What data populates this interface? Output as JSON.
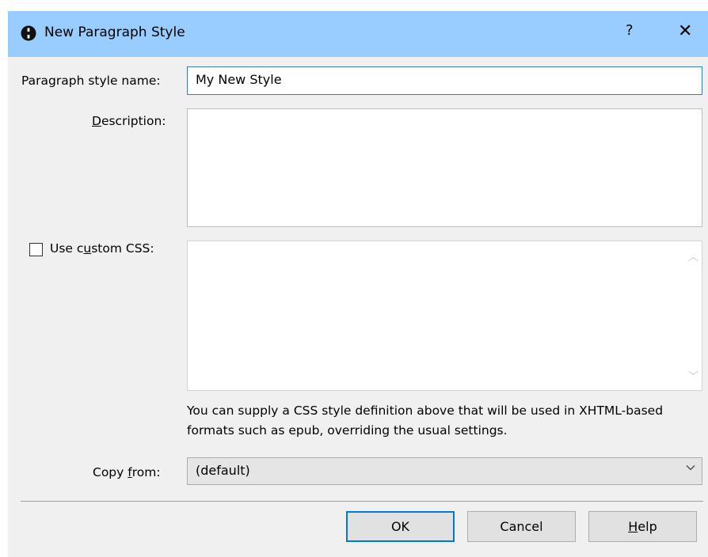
{
  "window": {
    "title": "New Paragraph Style",
    "help_glyph": "?",
    "close_glyph": "✕"
  },
  "form": {
    "name_label": "Paragraph style name:",
    "name_value": "My New Style",
    "description_label_pre": "",
    "description_label_u": "D",
    "description_label_post": "escription:",
    "description_value": "",
    "custom_css_label_pre": "Use c",
    "custom_css_label_u": "u",
    "custom_css_label_post": "stom CSS:",
    "custom_css_checked": false,
    "custom_css_value": "",
    "css_note": "You can supply a CSS style definition above that will be used in XHTML-based formats such as epub, overriding the usual settings.",
    "copy_from_label_pre": "Copy ",
    "copy_from_label_u": "f",
    "copy_from_label_post": "rom:",
    "copy_from_value": "(default)"
  },
  "buttons": {
    "ok": "OK",
    "cancel": "Cancel",
    "help_u": "H",
    "help_post": "elp"
  },
  "icons": {
    "app": "app-logo-icon",
    "scroll_up": "scroll-up-arrow-icon",
    "scroll_down": "scroll-down-arrow-icon",
    "dropdown": "chevron-down-icon"
  },
  "colors": {
    "titlebar": "#99ccff",
    "dialog_bg": "#f0f0f0",
    "focus_border": "#0078d7"
  }
}
